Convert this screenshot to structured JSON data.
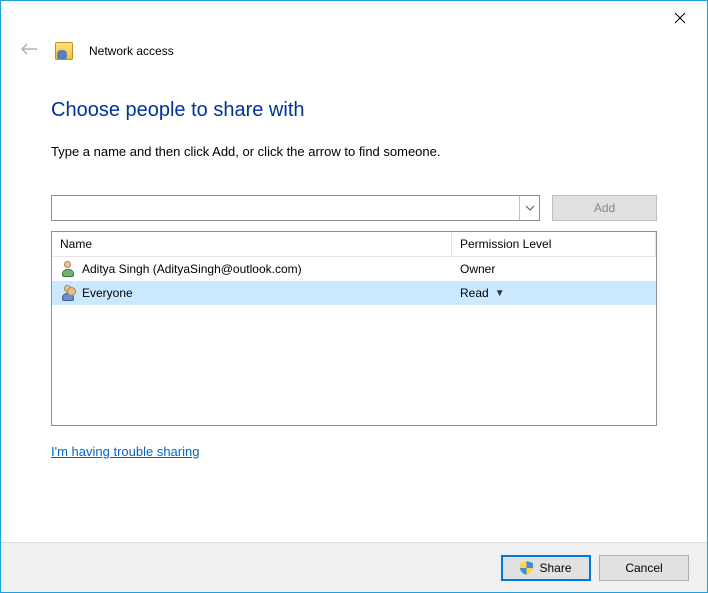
{
  "window": {
    "title": "Network access"
  },
  "heading": "Choose people to share with",
  "instruction": "Type a name and then click Add, or click the arrow to find someone.",
  "add": {
    "input_value": "",
    "button_label": "Add"
  },
  "columns": {
    "name": "Name",
    "permission": "Permission Level"
  },
  "rows": [
    {
      "name": "Aditya Singh (AdityaSingh@outlook.com)",
      "permission": "Owner",
      "type": "user",
      "selected": false,
      "editable": false
    },
    {
      "name": "Everyone",
      "permission": "Read",
      "type": "group",
      "selected": true,
      "editable": true
    }
  ],
  "trouble_link": "I'm having trouble sharing",
  "footer": {
    "share": "Share",
    "cancel": "Cancel"
  }
}
